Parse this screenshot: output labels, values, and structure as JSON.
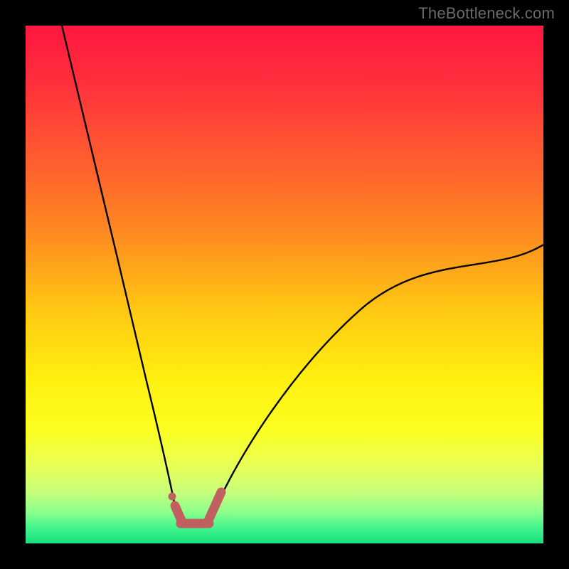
{
  "watermark": "TheBottleneck.com",
  "colors": {
    "frame": "#000000",
    "gradient_stops": [
      {
        "offset": 0.0,
        "color": "#ff173f"
      },
      {
        "offset": 0.1,
        "color": "#ff2d3d"
      },
      {
        "offset": 0.25,
        "color": "#ff5a30"
      },
      {
        "offset": 0.4,
        "color": "#ff8a20"
      },
      {
        "offset": 0.55,
        "color": "#ffc813"
      },
      {
        "offset": 0.68,
        "color": "#ffef10"
      },
      {
        "offset": 0.78,
        "color": "#fbff20"
      },
      {
        "offset": 0.85,
        "color": "#e8ff55"
      },
      {
        "offset": 0.9,
        "color": "#c8ff7a"
      },
      {
        "offset": 0.94,
        "color": "#8cff8c"
      },
      {
        "offset": 0.97,
        "color": "#40f58c"
      },
      {
        "offset": 1.0,
        "color": "#18e080"
      }
    ],
    "marker_fill": "#c16060",
    "curve": "#000000"
  },
  "chart_data": {
    "type": "line",
    "title": "",
    "xlabel": "",
    "ylabel": "",
    "xlim": [
      0,
      100
    ],
    "ylim": [
      0,
      100
    ],
    "grid": false,
    "watermark": "TheBottleneck.com",
    "series": [
      {
        "name": "left-curve",
        "x": [
          7,
          8,
          10,
          12,
          14,
          16,
          18,
          20,
          22,
          24,
          26,
          27.5,
          28.5,
          29.3
        ],
        "y": [
          100,
          93,
          80,
          68,
          57,
          47,
          38,
          30,
          23,
          17,
          11.5,
          8.5,
          6.5,
          5.3
        ]
      },
      {
        "name": "right-curve",
        "x": [
          36,
          38,
          41,
          45,
          50,
          56,
          63,
          71,
          80,
          90,
          100
        ],
        "y": [
          5.3,
          7.5,
          11,
          16,
          22,
          28.5,
          35,
          41.5,
          47.5,
          53,
          57.5
        ]
      },
      {
        "name": "flat-minimum",
        "x": [
          29.3,
          30.5,
          32,
          33.5,
          35,
          36
        ],
        "y": [
          5.3,
          3.8,
          3.2,
          3.2,
          3.8,
          5.3
        ]
      }
    ],
    "markers": [
      {
        "name": "left-marker-dot",
        "x": 28.3,
        "y": 9.0
      },
      {
        "name": "flat-segment",
        "from": [
          30.0,
          4.0
        ],
        "to": [
          35.5,
          4.0
        ]
      },
      {
        "name": "left-shoulder",
        "from": [
          28.8,
          7.5
        ],
        "to": [
          30.2,
          4.2
        ]
      },
      {
        "name": "right-shoulder",
        "from": [
          35.3,
          4.2
        ],
        "to": [
          37.5,
          9.8
        ]
      }
    ]
  }
}
